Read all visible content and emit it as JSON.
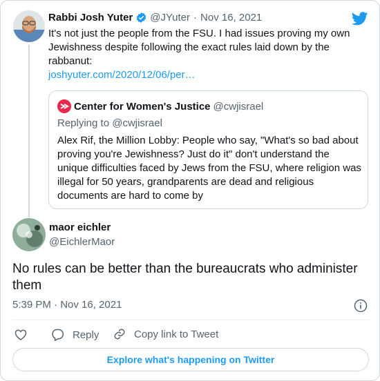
{
  "parent_tweet": {
    "author_name": "Rabbi Josh Yuter",
    "author_handle": "@JYuter",
    "separator": "·",
    "date": "Nov 16, 2021",
    "text": "It's not just the people from the FSU. I had issues proving my own Jewishness despite following the exact rules laid down by the rabbanut:",
    "link": "joshyuter.com/2020/12/06/per…"
  },
  "quoted_tweet": {
    "author_name": "Center for Women's Justice",
    "author_handle": "@cwjisrael",
    "replying_to": "Replying to @cwjisrael",
    "text": "Alex Rif, the Million Lobby: People who say, \"What's so bad about proving you're Jewishness? Just do it\" don't understand the unique difficulties faced by Jews from the FSU, where religion was illegal for 50 years, grandparents are dead and religious documents are hard to come by"
  },
  "main_tweet": {
    "author_name": "maor eichler",
    "author_handle": "@EichlerMaor",
    "text": "No rules can be better than the bureaucrats who administer them",
    "timestamp": "5:39 PM · Nov 16, 2021"
  },
  "actions": {
    "reply_label": "Reply",
    "copy_link_label": "Copy link to Tweet"
  },
  "footer": {
    "explore_label": "Explore what's happening on Twitter"
  },
  "colors": {
    "accent": "#1d9bf0",
    "verified": "#1d9bf0",
    "cwj_logo": "#e8294b",
    "muted_text": "#536471"
  },
  "icons": [
    "twitter-logo-icon",
    "verified-badge-icon",
    "cwj-logo-icon",
    "info-icon",
    "heart-icon",
    "reply-icon",
    "link-icon"
  ]
}
